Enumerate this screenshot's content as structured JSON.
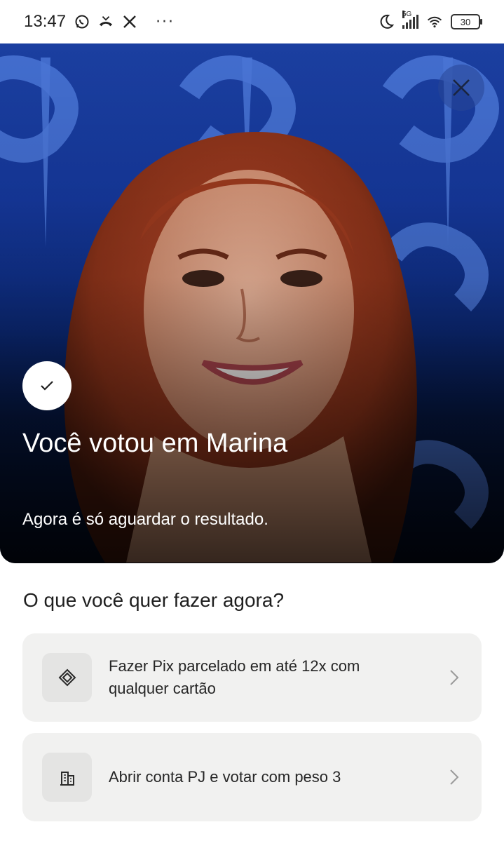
{
  "status_bar": {
    "time": "13:47",
    "icons": [
      "whatsapp-icon",
      "missed-call-icon",
      "x-icon",
      "more-dots",
      "moon-icon",
      "signal-5g-icon",
      "wifi-icon",
      "battery-icon"
    ],
    "network": "5G",
    "battery": "30"
  },
  "hero": {
    "title": "Você votou em Marina",
    "subtitle": "Agora é só aguardar o resultado.",
    "close_icon": "close-icon",
    "check_icon": "check-icon",
    "colors": {
      "top": "#1b3fa0",
      "bottom": "#020b1f"
    }
  },
  "sheet": {
    "question": "O que você quer fazer agora?",
    "options": [
      {
        "label": "Fazer Pix parcelado em até 12x com qualquer cartão",
        "icon": "pix-icon"
      },
      {
        "label": "Abrir conta PJ e votar com peso 3",
        "icon": "building-icon"
      }
    ]
  }
}
